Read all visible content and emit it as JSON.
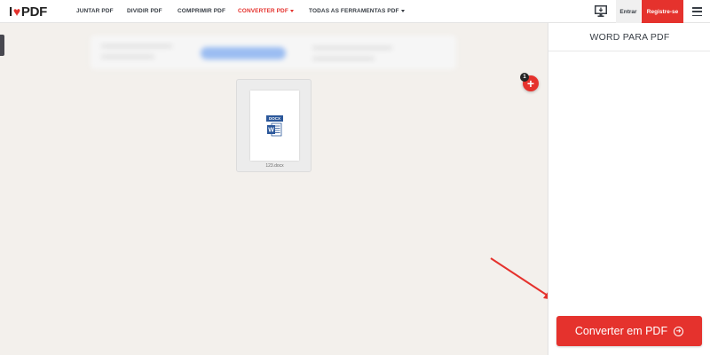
{
  "header": {
    "logo": {
      "prefix": "I",
      "heart": "♥",
      "suffix": "PDF"
    },
    "nav": [
      {
        "label": "JUNTAR PDF",
        "active": false
      },
      {
        "label": "DIVIDIR PDF",
        "active": false
      },
      {
        "label": "COMPRIMIR PDF",
        "active": false
      },
      {
        "label": "CONVERTER PDF",
        "active": true,
        "has_caret": true
      },
      {
        "label": "TODAS AS FERRAMENTAS PDF",
        "active": false,
        "has_caret": true
      }
    ],
    "desktop_icon": "monitor-download-icon",
    "login_label": "Entrar",
    "register_label": "Registre-se",
    "menu_icon": "hamburger-menu-icon"
  },
  "workspace": {
    "files": [
      {
        "name": "123.docx",
        "type_label": "DOCX",
        "icon": "word-doc-icon"
      }
    ],
    "file_count": "1",
    "add_icon": "+"
  },
  "sidebar": {
    "title": "WORD PARA PDF",
    "convert_label": "Converter em PDF",
    "convert_icon": "arrow-right-circle-icon"
  },
  "colors": {
    "brand_red": "#e5322d",
    "workspace_bg": "#f3f0ec",
    "word_blue": "#2b579a"
  }
}
